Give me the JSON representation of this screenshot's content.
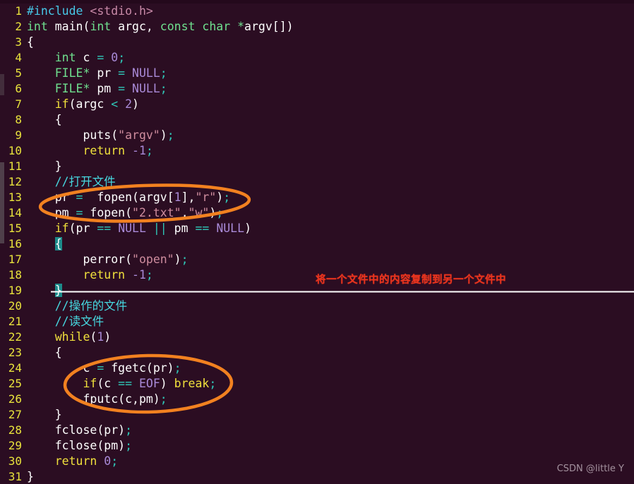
{
  "editor": {
    "background": "#2B0D22",
    "line_number_color": "#E8E23C",
    "first_line": 1,
    "last_line": 31,
    "language": "C"
  },
  "lines": [
    {
      "n": "1",
      "tokens": [
        {
          "t": "#include",
          "c": "pre"
        },
        {
          "t": " ",
          "c": "pl"
        },
        {
          "t": "<stdio.h>",
          "c": "hdr"
        }
      ]
    },
    {
      "n": "2",
      "tokens": [
        {
          "t": "int",
          "c": "kw"
        },
        {
          "t": " ",
          "c": "pl"
        },
        {
          "t": "main",
          "c": "pl"
        },
        {
          "t": "(",
          "c": "pl"
        },
        {
          "t": "int",
          "c": "kw"
        },
        {
          "t": " argc, ",
          "c": "pl"
        },
        {
          "t": "const",
          "c": "kw"
        },
        {
          "t": " ",
          "c": "pl"
        },
        {
          "t": "char",
          "c": "kw"
        },
        {
          "t": " ",
          "c": "pl"
        },
        {
          "t": "*",
          "c": "kw"
        },
        {
          "t": "argv[])",
          "c": "pl"
        }
      ]
    },
    {
      "n": "3",
      "tokens": [
        {
          "t": "{",
          "c": "pl"
        }
      ]
    },
    {
      "n": "4",
      "tokens": [
        {
          "t": "    ",
          "c": "pl"
        },
        {
          "t": "int",
          "c": "kw"
        },
        {
          "t": " c ",
          "c": "pl"
        },
        {
          "t": "=",
          "c": "op"
        },
        {
          "t": " ",
          "c": "pl"
        },
        {
          "t": "0",
          "c": "num"
        },
        {
          "t": ";",
          "c": "op"
        }
      ]
    },
    {
      "n": "5",
      "tokens": [
        {
          "t": "    ",
          "c": "pl"
        },
        {
          "t": "FILE*",
          "c": "kw"
        },
        {
          "t": " pr ",
          "c": "pl"
        },
        {
          "t": "=",
          "c": "op"
        },
        {
          "t": " ",
          "c": "pl"
        },
        {
          "t": "NULL",
          "c": "num"
        },
        {
          "t": ";",
          "c": "op"
        }
      ]
    },
    {
      "n": "6",
      "tokens": [
        {
          "t": "    ",
          "c": "pl"
        },
        {
          "t": "FILE*",
          "c": "kw"
        },
        {
          "t": " pm ",
          "c": "pl"
        },
        {
          "t": "=",
          "c": "op"
        },
        {
          "t": " ",
          "c": "pl"
        },
        {
          "t": "NULL",
          "c": "num"
        },
        {
          "t": ";",
          "c": "op"
        }
      ]
    },
    {
      "n": "7",
      "tokens": [
        {
          "t": "    ",
          "c": "pl"
        },
        {
          "t": "if",
          "c": "ctl"
        },
        {
          "t": "(argc ",
          "c": "pl"
        },
        {
          "t": "<",
          "c": "op"
        },
        {
          "t": " ",
          "c": "pl"
        },
        {
          "t": "2",
          "c": "num"
        },
        {
          "t": ")",
          "c": "pl"
        }
      ]
    },
    {
      "n": "8",
      "tokens": [
        {
          "t": "    {",
          "c": "pl"
        }
      ]
    },
    {
      "n": "9",
      "tokens": [
        {
          "t": "        puts(",
          "c": "pl"
        },
        {
          "t": "\"argv\"",
          "c": "str"
        },
        {
          "t": ")",
          "c": "pl"
        },
        {
          "t": ";",
          "c": "op"
        }
      ]
    },
    {
      "n": "10",
      "tokens": [
        {
          "t": "        ",
          "c": "pl"
        },
        {
          "t": "return",
          "c": "ctl"
        },
        {
          "t": " ",
          "c": "pl"
        },
        {
          "t": "-1",
          "c": "num"
        },
        {
          "t": ";",
          "c": "op"
        }
      ]
    },
    {
      "n": "11",
      "tokens": [
        {
          "t": "    }",
          "c": "pl"
        }
      ]
    },
    {
      "n": "12",
      "tokens": [
        {
          "t": "    ",
          "c": "pl"
        },
        {
          "t": "//打开文件",
          "c": "cmt"
        }
      ]
    },
    {
      "n": "13",
      "tokens": [
        {
          "t": "    pr ",
          "c": "pl"
        },
        {
          "t": "=",
          "c": "op"
        },
        {
          "t": "  fopen(argv[",
          "c": "pl"
        },
        {
          "t": "1",
          "c": "num"
        },
        {
          "t": "],",
          "c": "pl"
        },
        {
          "t": "\"r\"",
          "c": "str"
        },
        {
          "t": ")",
          "c": "pl"
        },
        {
          "t": ";",
          "c": "op"
        }
      ]
    },
    {
      "n": "14",
      "tokens": [
        {
          "t": "    pm ",
          "c": "pl"
        },
        {
          "t": "=",
          "c": "op"
        },
        {
          "t": " fopen(",
          "c": "pl"
        },
        {
          "t": "\"2.txt\"",
          "c": "str"
        },
        {
          "t": ",",
          "c": "pl"
        },
        {
          "t": "\"w\"",
          "c": "str"
        },
        {
          "t": ")",
          "c": "pl"
        },
        {
          "t": ";",
          "c": "op"
        }
      ]
    },
    {
      "n": "15",
      "tokens": [
        {
          "t": "    ",
          "c": "pl"
        },
        {
          "t": "if",
          "c": "ctl"
        },
        {
          "t": "(pr ",
          "c": "pl"
        },
        {
          "t": "==",
          "c": "op"
        },
        {
          "t": " ",
          "c": "pl"
        },
        {
          "t": "NULL",
          "c": "num"
        },
        {
          "t": " ",
          "c": "pl"
        },
        {
          "t": "||",
          "c": "op"
        },
        {
          "t": " pm ",
          "c": "pl"
        },
        {
          "t": "==",
          "c": "op"
        },
        {
          "t": " ",
          "c": "pl"
        },
        {
          "t": "NULL",
          "c": "num"
        },
        {
          "t": ")",
          "c": "pl"
        }
      ]
    },
    {
      "n": "16",
      "tokens": [
        {
          "t": "    ",
          "c": "pl"
        },
        {
          "t": "{",
          "c": "hl"
        }
      ]
    },
    {
      "n": "17",
      "tokens": [
        {
          "t": "        perror(",
          "c": "pl"
        },
        {
          "t": "\"open\"",
          "c": "str"
        },
        {
          "t": ")",
          "c": "pl"
        },
        {
          "t": ";",
          "c": "op"
        }
      ]
    },
    {
      "n": "18",
      "tokens": [
        {
          "t": "        ",
          "c": "pl"
        },
        {
          "t": "return",
          "c": "ctl"
        },
        {
          "t": " ",
          "c": "pl"
        },
        {
          "t": "-1",
          "c": "num"
        },
        {
          "t": ";",
          "c": "op"
        }
      ]
    },
    {
      "n": "19",
      "tokens": [
        {
          "t": "    ",
          "c": "pl"
        },
        {
          "t": "}",
          "c": "hl"
        }
      ]
    },
    {
      "n": "20",
      "tokens": [
        {
          "t": "    ",
          "c": "pl"
        },
        {
          "t": "//操作的文件",
          "c": "cmt"
        }
      ]
    },
    {
      "n": "21",
      "tokens": [
        {
          "t": "    ",
          "c": "pl"
        },
        {
          "t": "//读文件",
          "c": "cmt"
        }
      ]
    },
    {
      "n": "22",
      "tokens": [
        {
          "t": "    ",
          "c": "pl"
        },
        {
          "t": "while",
          "c": "ctl"
        },
        {
          "t": "(",
          "c": "pl"
        },
        {
          "t": "1",
          "c": "num"
        },
        {
          "t": ")",
          "c": "pl"
        }
      ]
    },
    {
      "n": "23",
      "tokens": [
        {
          "t": "    {",
          "c": "pl"
        }
      ]
    },
    {
      "n": "24",
      "tokens": [
        {
          "t": "        c ",
          "c": "pl"
        },
        {
          "t": "=",
          "c": "op"
        },
        {
          "t": " fgetc(pr)",
          "c": "pl"
        },
        {
          "t": ";",
          "c": "op"
        }
      ]
    },
    {
      "n": "25",
      "tokens": [
        {
          "t": "        ",
          "c": "pl"
        },
        {
          "t": "if",
          "c": "ctl"
        },
        {
          "t": "(c ",
          "c": "pl"
        },
        {
          "t": "==",
          "c": "op"
        },
        {
          "t": " ",
          "c": "pl"
        },
        {
          "t": "EOF",
          "c": "num"
        },
        {
          "t": ") ",
          "c": "pl"
        },
        {
          "t": "break",
          "c": "ctl"
        },
        {
          "t": ";",
          "c": "op"
        }
      ]
    },
    {
      "n": "26",
      "tokens": [
        {
          "t": "        fputc(c,pm)",
          "c": "pl"
        },
        {
          "t": ";",
          "c": "op"
        }
      ]
    },
    {
      "n": "27",
      "tokens": [
        {
          "t": "    }",
          "c": "pl"
        }
      ]
    },
    {
      "n": "28",
      "tokens": [
        {
          "t": "    fclose(pr)",
          "c": "pl"
        },
        {
          "t": ";",
          "c": "op"
        }
      ]
    },
    {
      "n": "29",
      "tokens": [
        {
          "t": "    fclose(pm)",
          "c": "pl"
        },
        {
          "t": ";",
          "c": "op"
        }
      ]
    },
    {
      "n": "30",
      "tokens": [
        {
          "t": "    ",
          "c": "pl"
        },
        {
          "t": "return",
          "c": "ctl"
        },
        {
          "t": " ",
          "c": "pl"
        },
        {
          "t": "0",
          "c": "num"
        },
        {
          "t": ";",
          "c": "op"
        }
      ]
    },
    {
      "n": "31",
      "tokens": [
        {
          "t": "}",
          "c": "pl"
        }
      ]
    }
  ],
  "annotations": {
    "ellipse_color": "#F28120",
    "note_color": "#E8341E",
    "divider_color": "#FFFFFF",
    "chinese_note": "将一个文件中的内容复制到另一个文件中",
    "ellipse_top_label": "fopen-calls-ellipse",
    "ellipse_bottom_label": "copy-loop-ellipse"
  },
  "watermark": {
    "text": "CSDN @little Y"
  }
}
